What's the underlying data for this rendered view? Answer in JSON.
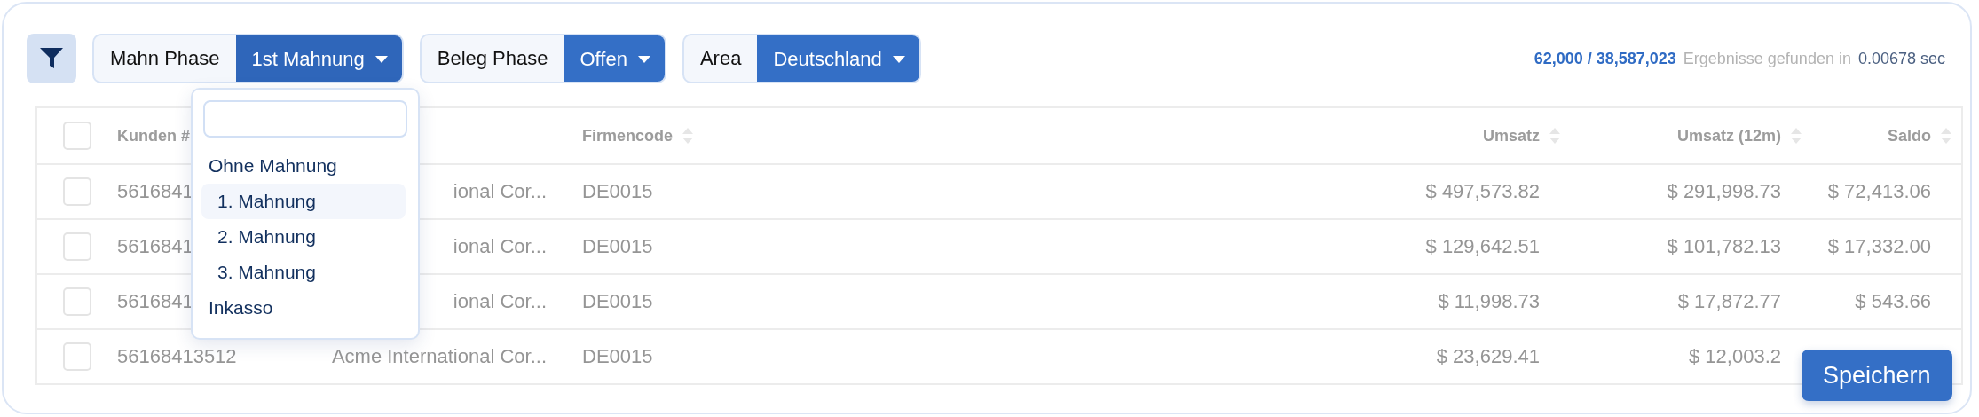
{
  "filters": [
    {
      "label": "Mahn Phase",
      "value": "1st Mahnung",
      "expanded": true
    },
    {
      "label": "Beleg Phase",
      "value": "Offen",
      "expanded": false
    },
    {
      "label": "Area",
      "value": "Deutschland",
      "expanded": false
    }
  ],
  "dropdown": {
    "items": [
      {
        "label": "Ohne Mahnung",
        "kind": "phase",
        "selected": false
      },
      {
        "label": "1. Mahnung",
        "kind": "step",
        "selected": true
      },
      {
        "label": "2. Mahnung",
        "kind": "step",
        "selected": false
      },
      {
        "label": "3. Mahnung",
        "kind": "step",
        "selected": false
      },
      {
        "label": "Inkasso",
        "kind": "phase",
        "selected": false
      }
    ]
  },
  "results": {
    "count": "62,000 / 38,587,023",
    "text": "Ergebnisse gefunden in",
    "time": "0.00678 sec"
  },
  "table": {
    "header_checked": false,
    "columns": [
      {
        "label": "Kunden #"
      },
      {},
      {
        "label": "Firmencode",
        "sortable": true
      },
      {
        "label": "Umsatz",
        "sortable": true
      },
      {
        "label": "Umsatz (12m)",
        "sortable": true
      },
      {
        "label": "Saldo",
        "sortable": true
      }
    ],
    "rows": [
      {
        "checked": false,
        "cells": [
          "5616841",
          "ional Cor...",
          "DE0015",
          "$ 497,573.82",
          "$ 291,998.73",
          "$ 72,413.06"
        ]
      },
      {
        "checked": false,
        "cells": [
          "5616841",
          "ional Cor...",
          "DE0015",
          "$ 129,642.51",
          "$ 101,782.13",
          "$ 17,332.00"
        ]
      },
      {
        "checked": false,
        "cells": [
          "5616841",
          "ional Cor...",
          "DE0015",
          "$ 11,998.73",
          "$ 17,872.77",
          "$ 543.66"
        ]
      },
      {
        "checked": false,
        "cells": [
          "56168413512",
          "Acme International Cor...",
          "DE0015",
          "$ 23,629.41",
          "$ 12,003.2"
        ]
      }
    ]
  },
  "save_button": {
    "label": "Speichern"
  }
}
